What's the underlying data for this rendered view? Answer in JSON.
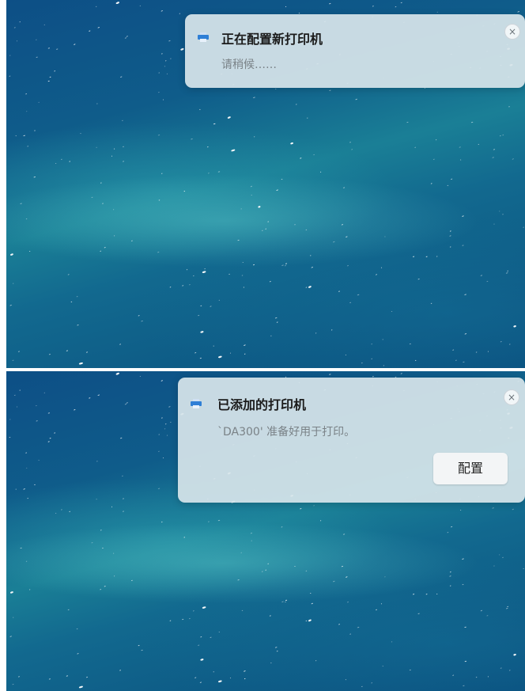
{
  "notifications": [
    {
      "icon": "printer-icon",
      "title": "正在配置新打印机",
      "body": "请稍候……",
      "close_label": "×"
    },
    {
      "icon": "printer-icon",
      "title": "已添加的打印机",
      "body": "`DA300' 准备好用于打印。",
      "action_label": "配置",
      "close_label": "×"
    }
  ],
  "colors": {
    "accent": "#2f7fd6",
    "notification_bg": "#d6e4ea",
    "wallpaper": "#0f5c8a"
  }
}
